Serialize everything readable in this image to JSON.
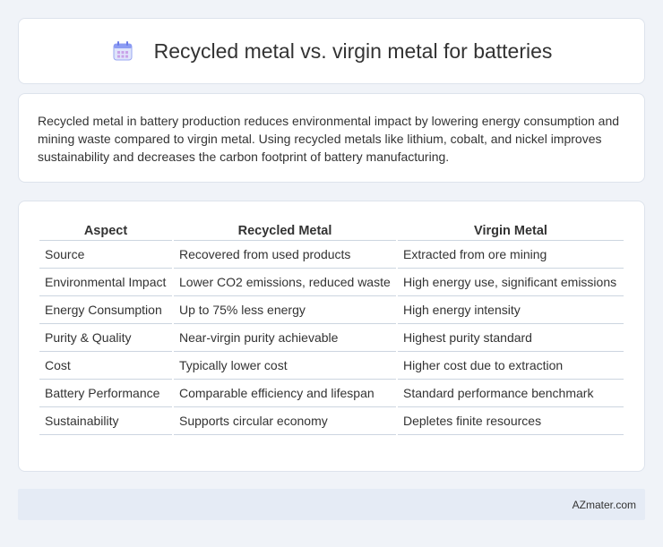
{
  "title": "Recycled metal vs. virgin metal for batteries",
  "intro": "Recycled metal in battery production reduces environmental impact by lowering energy consumption and mining waste compared to virgin metal. Using recycled metals like lithium, cobalt, and nickel improves sustainability and decreases the carbon footprint of battery manufacturing.",
  "table": {
    "headers": [
      "Aspect",
      "Recycled Metal",
      "Virgin Metal"
    ],
    "rows": [
      [
        "Source",
        "Recovered from used products",
        "Extracted from ore mining"
      ],
      [
        "Environmental Impact",
        "Lower CO2 emissions, reduced waste",
        "High energy use, significant emissions"
      ],
      [
        "Energy Consumption",
        "Up to 75% less energy",
        "High energy intensity"
      ],
      [
        "Purity & Quality",
        "Near-virgin purity achievable",
        "Highest purity standard"
      ],
      [
        "Cost",
        "Typically lower cost",
        "Higher cost due to extraction"
      ],
      [
        "Battery Performance",
        "Comparable efficiency and lifespan",
        "Standard performance benchmark"
      ],
      [
        "Sustainability",
        "Supports circular economy",
        "Depletes finite resources"
      ]
    ]
  },
  "footer": "AZmater.com",
  "icons": {
    "title_icon": "calendar-icon"
  },
  "colors": {
    "background": "#f0f3f8",
    "footer_bg": "#e5ebf5",
    "icon_accent": "#7a8cf0"
  }
}
